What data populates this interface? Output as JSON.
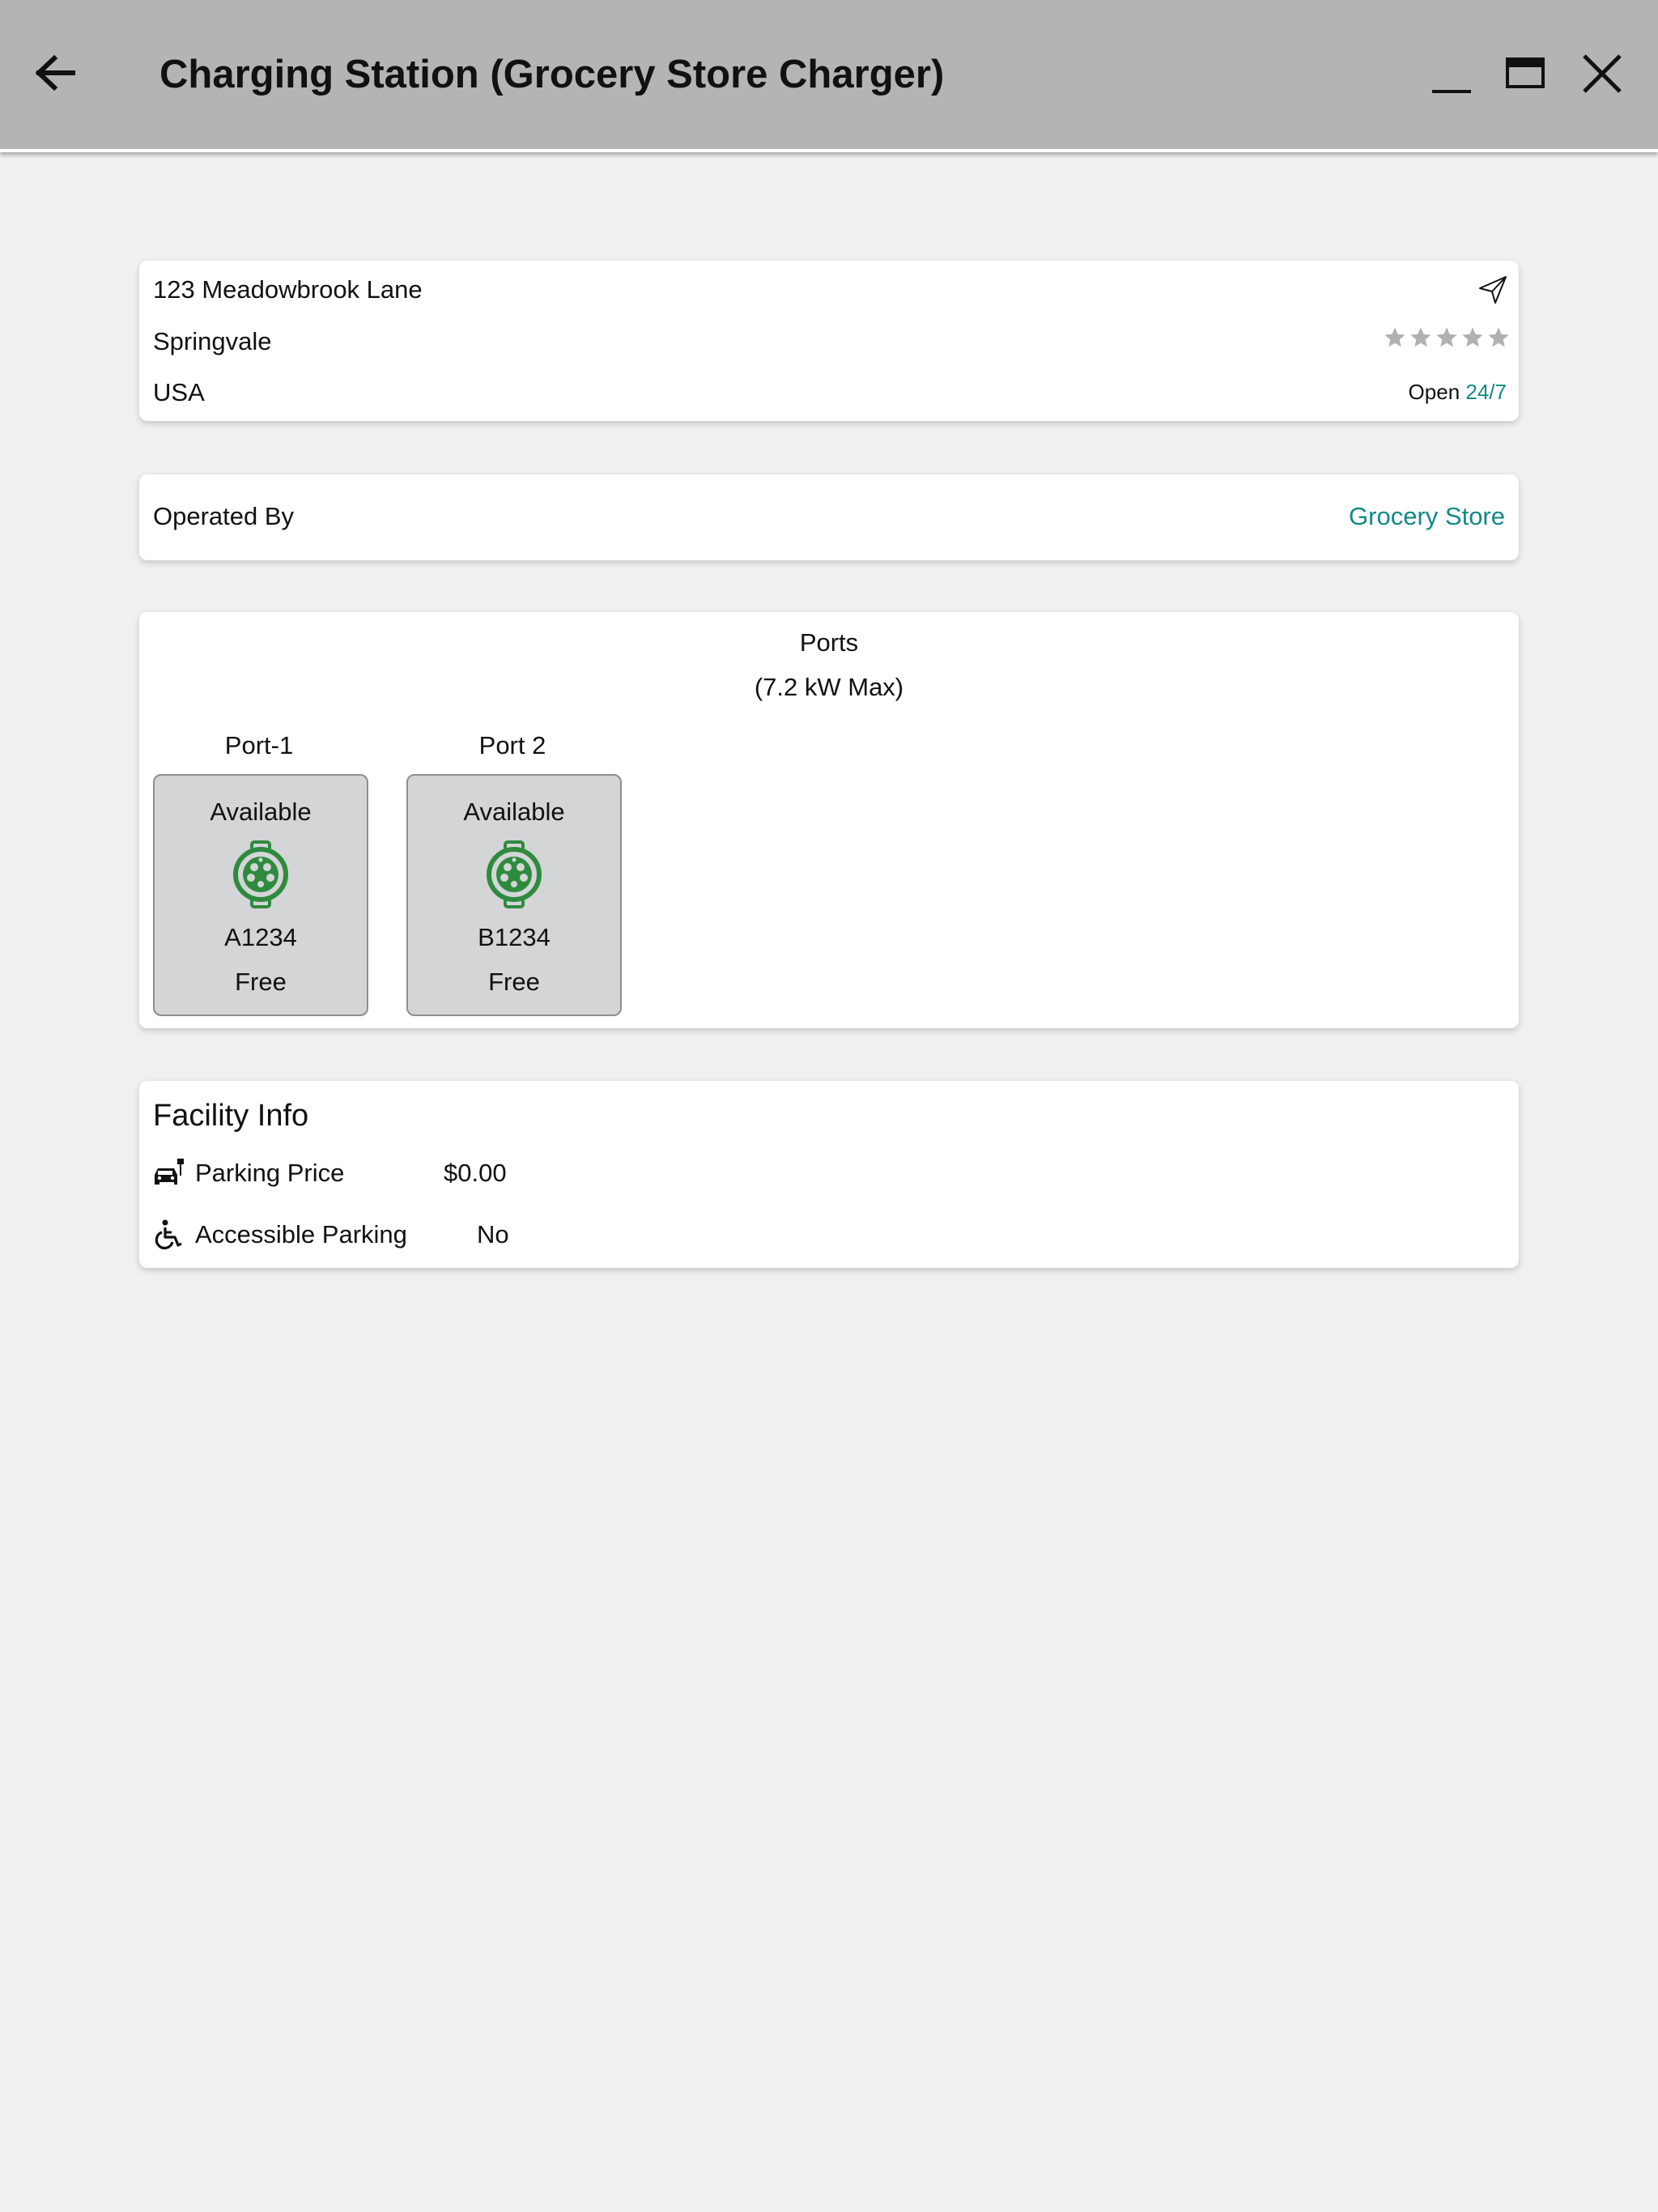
{
  "window": {
    "title": "Charging Station (Grocery Store Charger)",
    "icons": {
      "back": "arrow-left-icon",
      "minimize": "minimize-icon",
      "maximize": "maximize-icon",
      "close": "close-icon"
    }
  },
  "address": {
    "street": "123 Meadowbrook Lane",
    "city": "Springvale",
    "country": "USA",
    "rating": 0,
    "rating_max": 5,
    "hours_prefix": "Open",
    "hours_value": "24/7",
    "nav_icon": "navigate-icon"
  },
  "operator": {
    "label": "Operated By",
    "name": "Grocery Store"
  },
  "ports": {
    "title": "Ports",
    "subtitle": "(7.2 kW Max)",
    "items": [
      {
        "name": "Port-1",
        "status": "Available",
        "id": "A1234",
        "price": "Free",
        "icon": "type2-connector-icon"
      },
      {
        "name": "Port 2",
        "status": "Available",
        "id": "B1234",
        "price": "Free",
        "icon": "type2-connector-icon"
      }
    ]
  },
  "facility": {
    "title": "Facility Info",
    "rows": [
      {
        "label": "Parking Price",
        "value": "$0.00",
        "icon": "parking-car-icon"
      },
      {
        "label": "Accessible Parking",
        "value": "No",
        "icon": "wheelchair-icon"
      }
    ]
  },
  "colors": {
    "header_bg": "#b4b4b4",
    "page_bg": "#f0f0f0",
    "accent_teal": "#128a86",
    "connector_green": "#2e8b3e",
    "port_card_bg": "#d4d5d7",
    "star_gray": "#b0b0b0"
  }
}
